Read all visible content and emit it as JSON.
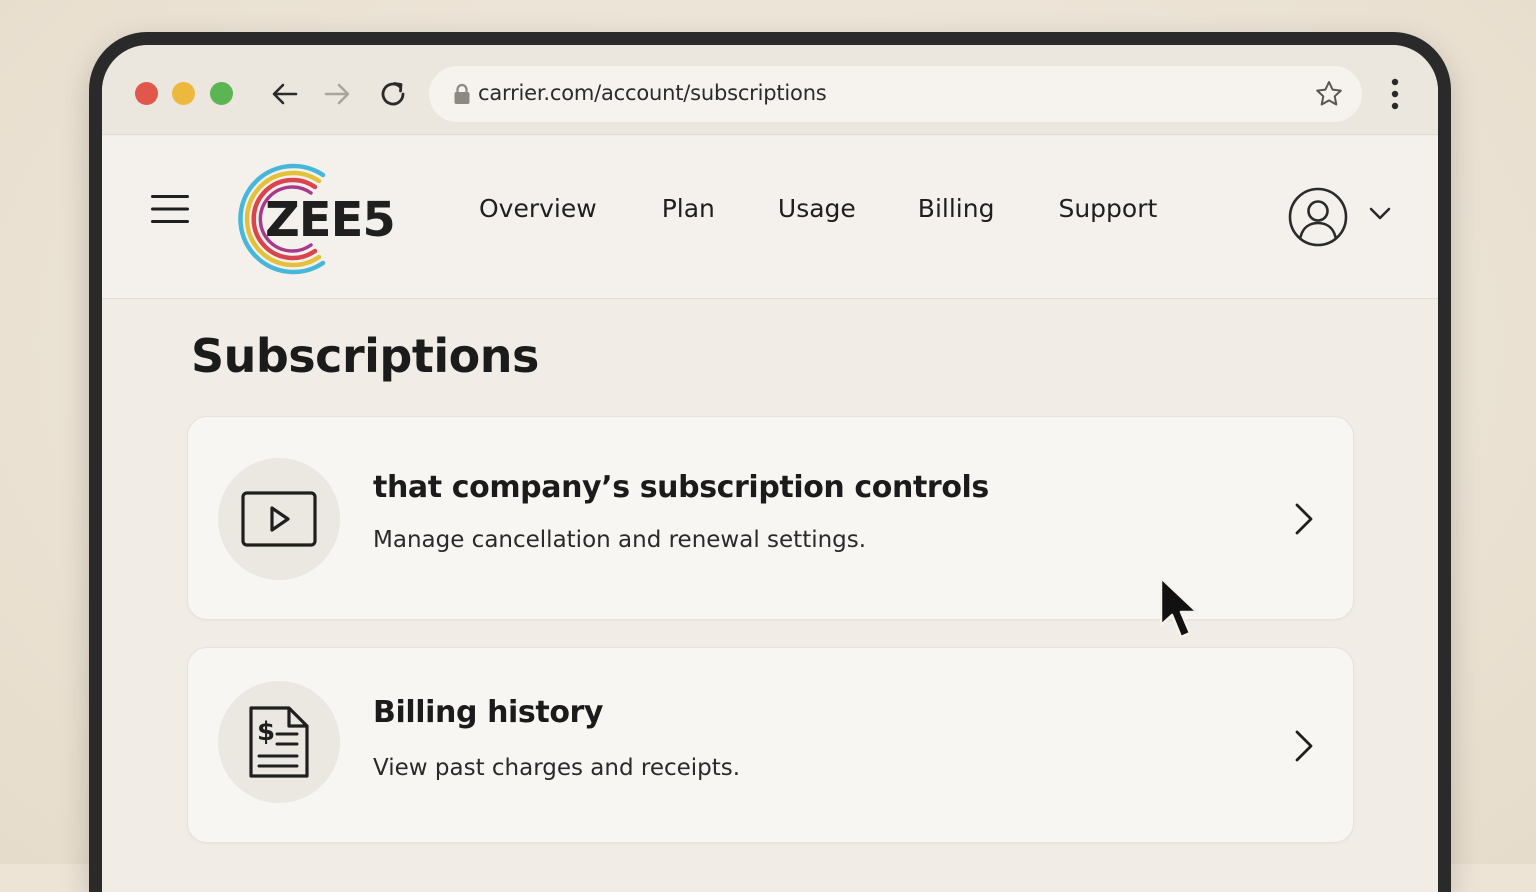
{
  "browser": {
    "url": "carrier.com/account/subscriptions"
  },
  "header": {
    "logo_text": "ZEE5",
    "nav": [
      {
        "label": "Overview"
      },
      {
        "label": "Plan"
      },
      {
        "label": "Usage"
      },
      {
        "label": "Billing"
      },
      {
        "label": "Support"
      }
    ]
  },
  "main": {
    "title": "Subscriptions",
    "cards": [
      {
        "title": "that company’s subscription controls",
        "description": "Manage cancellation and renewal settings.",
        "icon": "video-play-icon"
      },
      {
        "title": "Billing history",
        "description": "View past charges and receipts.",
        "icon": "receipt-dollar-icon"
      }
    ]
  },
  "colors": {
    "background": "#ede4d6",
    "device_frame": "#2a2a2a",
    "traffic_red": "#e2574c",
    "traffic_yellow": "#edb83e",
    "traffic_green": "#5ab552",
    "text_primary": "#1b1b1b"
  }
}
